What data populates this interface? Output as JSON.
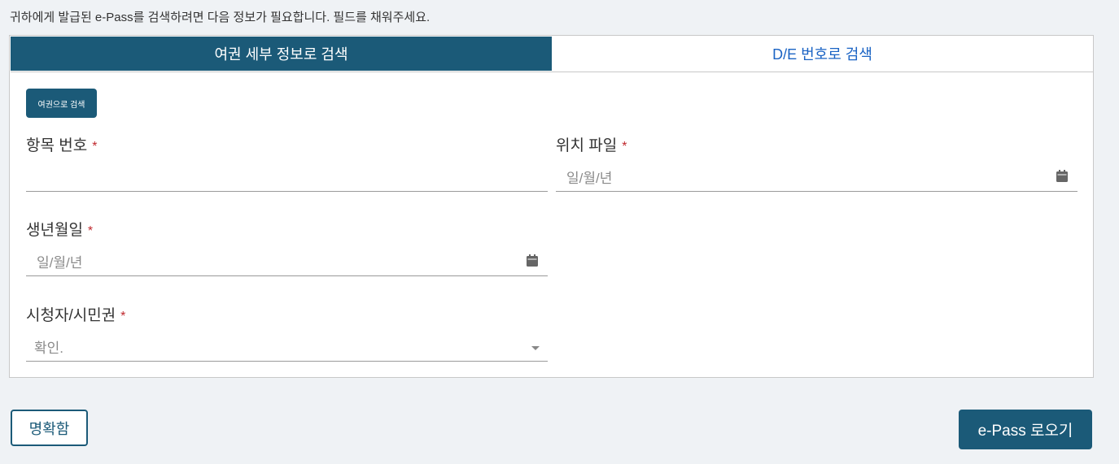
{
  "intro_text": "귀하에게 발급된 e-Pass를 검색하려면 다음 정보가 필요합니다. 필드를 채워주세요.",
  "tabs": [
    {
      "label": "여권 세부 정보로 검색",
      "active": true
    },
    {
      "label": "D/E 번호로 검색",
      "active": false
    }
  ],
  "search_by_passport_label": "여권으로 검색",
  "fields": {
    "item_number": {
      "label": "항목 번호",
      "required_mark": "*",
      "value": ""
    },
    "location_file": {
      "label": "위치 파일",
      "required_mark": "*",
      "placeholder": "일/월/년",
      "icon": "calendar-icon"
    },
    "birth_date": {
      "label": "생년월일",
      "required_mark": "*",
      "placeholder": "일/월/년",
      "icon": "calendar-icon"
    },
    "citizenship": {
      "label": "시청자/시민권",
      "required_mark": "*",
      "selected": "확인.",
      "icon": "chevron-down-icon"
    }
  },
  "buttons": {
    "clear_label": "명확함",
    "lookup_label": "e-Pass 로오기"
  },
  "colors": {
    "primary": "#1b5a78",
    "link": "#1a63c4",
    "required": "#c0282d",
    "background": "#eff2f5"
  }
}
